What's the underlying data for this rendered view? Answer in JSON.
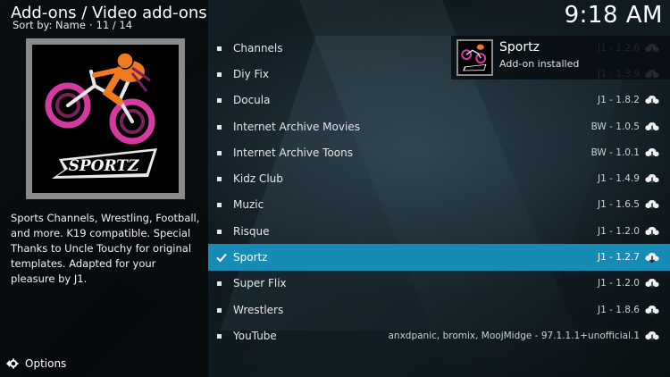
{
  "header": {
    "title": "Add-ons / Video add-ons",
    "sort_label": "Sort by: Name",
    "separator": "·",
    "position": "11 / 14",
    "clock": "9:18 AM"
  },
  "selected_addon": {
    "logo_text": "SPORTZ",
    "description": "Sports Channels, Wrestling, Football, and more. K19 compatible. Special Thanks to Uncle Touchy for original templates. Adapted for your pleasure by J1."
  },
  "footer": {
    "options_label": "Options",
    "options_icon": "options-icon"
  },
  "notification": {
    "title": "Sportz",
    "message": "Add-on installed"
  },
  "addons": [
    {
      "name": "Channels",
      "version": "J1 - 1.2.6",
      "selected": false
    },
    {
      "name": "Diy Fix",
      "version": "J1 - 1.3.9",
      "selected": false
    },
    {
      "name": "Docula",
      "version": "J1 - 1.8.2",
      "selected": false
    },
    {
      "name": "Internet Archive Movies",
      "version": "BW - 1.0.5",
      "selected": false
    },
    {
      "name": "Internet Archive Toons",
      "version": "BW - 1.0.1",
      "selected": false
    },
    {
      "name": "Kidz Club",
      "version": "J1 - 1.4.9",
      "selected": false
    },
    {
      "name": "Muzic",
      "version": "J1 - 1.6.5",
      "selected": false
    },
    {
      "name": "Risque",
      "version": "J1 - 1.2.0",
      "selected": false
    },
    {
      "name": "Sportz",
      "version": "J1 - 1.2.7",
      "selected": true
    },
    {
      "name": "Super Flix",
      "version": "J1 - 1.2.0",
      "selected": false
    },
    {
      "name": "Wrestlers",
      "version": "J1 - 1.8.6",
      "selected": false
    },
    {
      "name": "YouTube",
      "version": "anxdpanic, bromix, MoojMidge - 97.1.1.1+unofficial.1",
      "selected": false
    }
  ],
  "colors": {
    "selected_row": "#168bb6",
    "accent_pink": "#d63aa0",
    "accent_orange": "#f07a20"
  }
}
